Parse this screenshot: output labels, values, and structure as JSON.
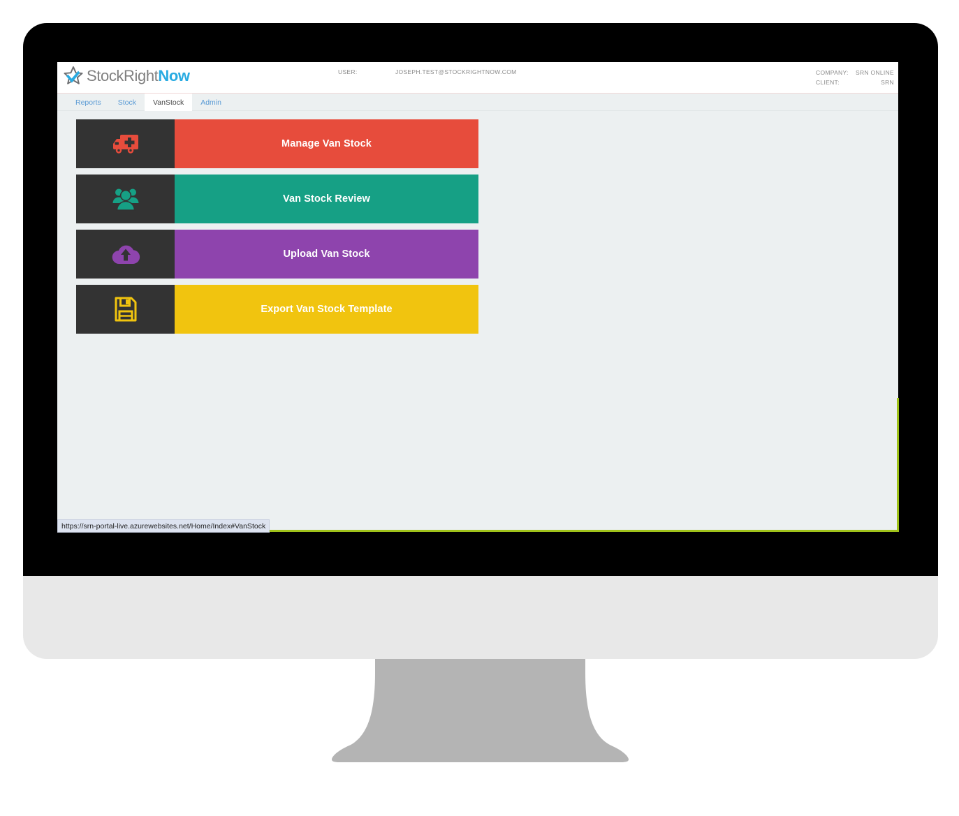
{
  "brand": {
    "text_primary": "StockRight",
    "text_accent": "Now",
    "icon": "star-logo-icon"
  },
  "header": {
    "user_label": "USER:",
    "user_value": "JOSEPH.TEST@STOCKRIGHTNOW.COM",
    "company_label": "COMPANY:",
    "company_value": "SRN ONLINE",
    "client_label": "CLIENT:",
    "client_value": "SRN"
  },
  "nav": {
    "tabs": [
      {
        "label": "Reports",
        "active": false
      },
      {
        "label": "Stock",
        "active": false
      },
      {
        "label": "VanStock",
        "active": true
      },
      {
        "label": "Admin",
        "active": false
      }
    ]
  },
  "cards": [
    {
      "label": "Manage Van Stock",
      "color": "#e74c3c",
      "icon": "ambulance-icon",
      "icon_panel_color": "#333333"
    },
    {
      "label": "Van Stock Review",
      "color": "#16a085",
      "icon": "users-group-icon",
      "icon_panel_color": "#333333"
    },
    {
      "label": "Upload Van Stock",
      "color": "#8e44ad",
      "icon": "cloud-upload-icon",
      "icon_panel_color": "#333333"
    },
    {
      "label": "Export Van Stock Template",
      "color": "#f1c40f",
      "icon": "floppy-save-icon",
      "icon_panel_color": "#333333"
    }
  ],
  "status_bar": {
    "url": "https://srn-portal-live.azurewebsites.net/Home/Index#VanStock"
  },
  "theme": {
    "page_background": "#ecf0f1",
    "header_background": "#ffffff",
    "bezel_color": "#000000",
    "chin_color": "#e8e8e8",
    "stand_color": "#b4b4b4",
    "accent_blue": "#29abe2",
    "link_blue": "#5b9bd5",
    "viewport_edge": "#9fc21a"
  }
}
